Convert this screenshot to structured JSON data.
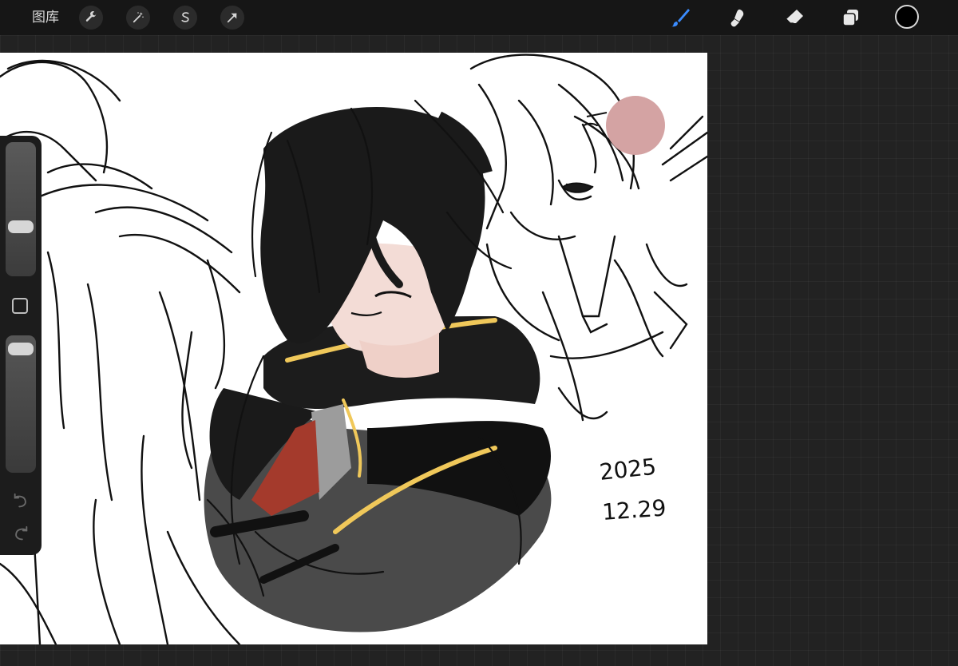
{
  "topbar": {
    "gallery_label": "图库",
    "left_tools": [
      {
        "name": "adjustments",
        "icon": "wrench-icon"
      },
      {
        "name": "adjust",
        "icon": "magic-wand-icon"
      },
      {
        "name": "selection",
        "icon": "selection-s-icon"
      },
      {
        "name": "transform",
        "icon": "arrow-cursor-icon"
      }
    ],
    "right_tools": [
      {
        "name": "brush",
        "icon": "brush-icon",
        "active": true
      },
      {
        "name": "smudge",
        "icon": "smudge-finger-icon"
      },
      {
        "name": "eraser",
        "icon": "eraser-icon"
      },
      {
        "name": "layers",
        "icon": "layers-icon"
      }
    ],
    "current_color": "#000000",
    "active_color": "#3b8cff"
  },
  "sidebar": {
    "size_slider_value": 0.35,
    "opacity_slider_value": 0.96
  },
  "canvas": {
    "date_line1": "2025",
    "date_line2": "12.29",
    "colors": {
      "hair": "#1a1a1a",
      "skin": "#f3dcd6",
      "tie": "#a43a2c",
      "trim": "#f0c85a",
      "coat_gray": "#4a4a4a",
      "pink_dot": "#d4a3a3"
    }
  }
}
